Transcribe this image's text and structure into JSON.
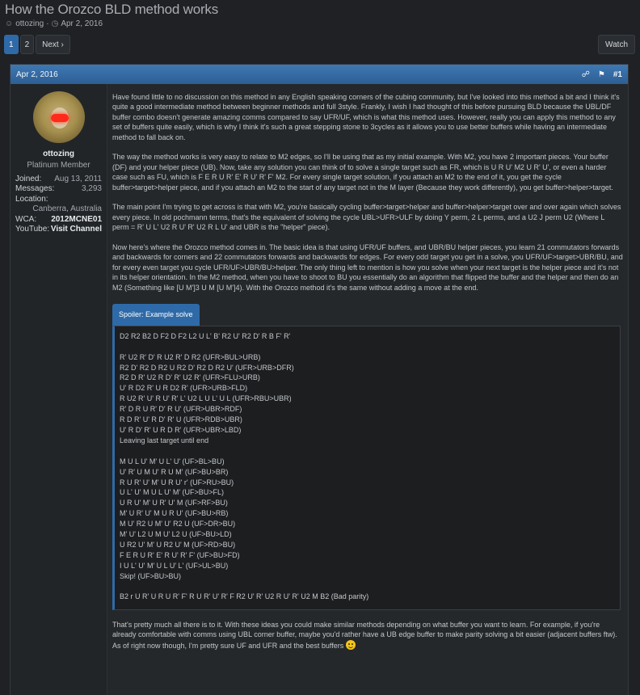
{
  "thread": {
    "title": "How the Orozco BLD method works",
    "author": "ottozing",
    "separator": "·",
    "date": "Apr 2, 2016"
  },
  "pagination": {
    "pages": [
      "1",
      "2"
    ],
    "next_label": "Next ›"
  },
  "watch_label": "Watch",
  "post": {
    "date": "Apr 2, 2016",
    "number": "#1",
    "user": {
      "name": "ottozing",
      "title": "Platinum Member",
      "joined_label": "Joined:",
      "joined": "Aug 13, 2011",
      "messages_label": "Messages:",
      "messages": "3,293",
      "location_label": "Location:",
      "location": "Canberra, Australia",
      "wca_label": "WCA:",
      "wca": "2012MCNE01",
      "youtube_label": "YouTube:",
      "youtube": "Visit Channel"
    },
    "paragraphs": [
      "Have found little to no discussion on this method in any English speaking corners of the cubing community, but I've looked into this method a bit and I think it's quite a good intermediate method between beginner methods and full 3style. Frankly, I wish I had thought of this before pursuing BLD because the UBL/DF buffer combo doesn't generate amazing comms compared to say UFR/UF, which is what this method uses. However, really you can apply this method to any set of buffers quite easily, which is why I think it's such a great stepping stone to 3cycles as it allows you to use better buffers while having an intermediate method to fall back on.",
      "The way the method works is very easy to relate to M2 edges, so I'll be using that as my initial example. With M2, you have 2 important pieces. Your buffer (DF) and your helper piece (UB). Now, take any solution you can think of to solve a single target such as FR, which is U R U' M2 U R' U', or even a harder case such as FU, which is F E R U R' E' R U' R' F' M2. For every single target solution, if you attach an M2 to the end of it, you get the cycle buffer>target>helper piece, and if you attach an M2 to the start of any target not in the M layer (Because they work differently), you get buffer>helper>target.",
      "The main point I'm trying to get across is that with M2, you're basically cycling buffer>target>helper and buffer>helper>target over and over again which solves every piece. In old pochmann terms, that's the equivalent of solving the cycle UBL>UFR>ULF by doing Y perm, 2 L perms, and a U2 J perm U2 (Where L perm = R' U L' U2 R U' R' U2 R L U' and UBR is the \"helper\" piece).",
      "Now here's where the Orozco method comes in. The basic idea is that using UFR/UF buffers, and UBR/BU helper pieces, you learn 21 commutators forwards and backwards for corners and 22 commutators forwards and backwards for edges. For every odd target you get in a solve, you UFR/UF>target>UBR/BU, and for every even target you cycle UFR/UF>UBR/BU>helper. The only thing left to mention is how you solve when your next target is the helper piece and it's not in its helper orientation. In the M2 method, when you have to shoot to BU you essentially do an algorithm that flipped the buffer and the helper and then do an M2 (Something like [U M']3 U M [U M']4). With the Orozco method it's the same without adding a move at the end."
    ],
    "spoiler_label": "Spoiler: Example solve",
    "spoiler_lines": [
      "D2 R2 B2 D F2 D F2 L2 U L' B' R2 U' R2 D' R B F' R'",
      "",
      "R' U2 R' D' R U2 R' D R2 (UFR>BUL>URB)",
      "R2 D' R2 D R2 U R2 D' R2 D R2 U' (UFR>URB>DFR)",
      "R2 D R' U2 R D' R' U2 R' (UFR>FLU>URB)",
      "U' R D2 R' U R D2 R' (UFR>URB>FLD)",
      "R U2 R' U' R U' R' L' U2 L U L' U L (UFR>RBU>UBR)",
      "R' D R U R' D' R U' (UFR>UBR>RDF)",
      "R D R' U' R D' R' U (UFR>RDB>UBR)",
      "U' R D' R' U R D R' (UFR>UBR>LBD)",
      "Leaving last target until end",
      "",
      "M U L U' M' U L' U' (UF>BL>BU)",
      "U' R' U M U' R U M' (UF>BU>BR)",
      "R U R' U' M' U R U' r' (UF>RU>BU)",
      "U L' U' M U L U' M' (UF>BU>FL)",
      "U R U' M' U R' U' M (UF>RF>BU)",
      "M' U R' U' M U R U' (UF>BU>RB)",
      "M U' R2 U M' U' R2 U (UF>DR>BU)",
      "M' U' L2 U M U' L2 U (UF>BU>LD)",
      "U R2 U' M' U R2 U' M (UF>RD>BU)",
      "F E R U R' E' R U' R' F' (UF>BU>FD)",
      "I U L' U' M' U L U' L' (UF>UL>BU)",
      "Skip! (UF>BU>BU)",
      "",
      "B2 r U R' U R U R' F' R U R' U' R' F R2 U' R' U2 R U' R' U2 M B2 (Bad parity)"
    ],
    "closing": "That's pretty much all there is to it. With these ideas you could make similar methods depending on what buffer you want to learn. For example, if you're already comfortable with comms using UBL corner buffer, maybe you'd rather have a UB edge buffer to make parity solving a bit easier (adjacent buffers ftw). As of right now though, I'm pretty sure UF and UFR and the best buffers"
  }
}
